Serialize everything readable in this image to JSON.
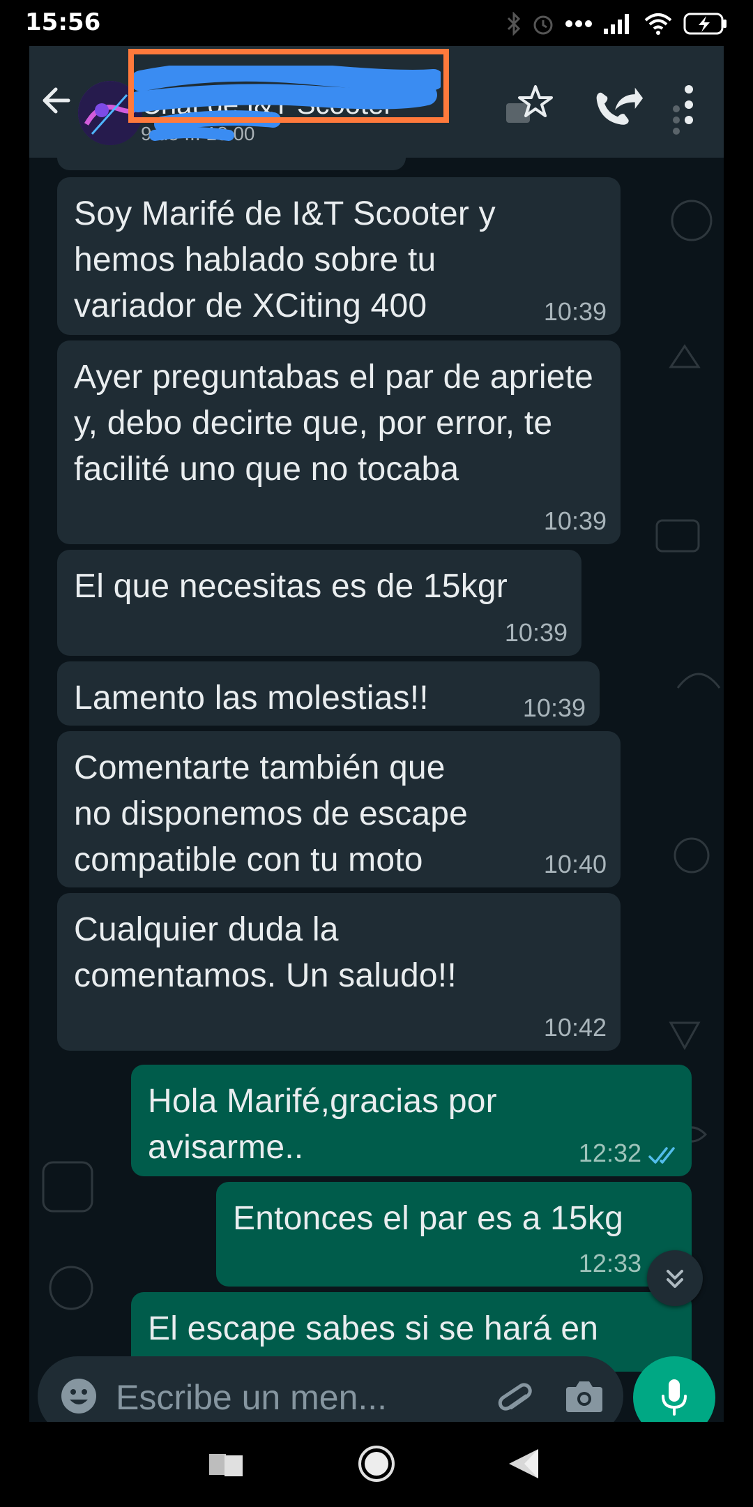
{
  "status_bar": {
    "time": "15:56"
  },
  "header": {
    "contact_name": "Chat de I&T Scooter",
    "contact_status": "9 de ... 18:00"
  },
  "messages": [
    {
      "direction": "in",
      "text": "Soy Marifé de I&T Scooter y hemos hablado sobre tu variador de XCiting 400",
      "time": "10:39"
    },
    {
      "direction": "in",
      "text": "Ayer preguntabas el par de apriete y, debo decirte que, por error, te facilité uno que no tocaba",
      "time": "10:39"
    },
    {
      "direction": "in",
      "text": "El que necesitas es de 15kgr",
      "time": "10:39"
    },
    {
      "direction": "in",
      "text": "Lamento las molestias!!",
      "time": "10:39"
    },
    {
      "direction": "in",
      "text": "Comentarte también que no disponemos de escape compatible con tu moto",
      "time": "10:40"
    },
    {
      "direction": "in",
      "text": "Cualquier duda la comentamos. Un saludo!!",
      "time": "10:42"
    },
    {
      "direction": "out",
      "text": "Hola Marifé,gracias por avisarme..",
      "time": "12:32",
      "status": "read"
    },
    {
      "direction": "out",
      "text": "Entonces el par es a 15kg",
      "time": "12:33"
    },
    {
      "direction": "out",
      "text": "El escape sabes si se hará en",
      "time": ""
    }
  ],
  "composer": {
    "placeholder": "Escribe un men..."
  },
  "colors": {
    "incoming_bubble": "#1f2c34",
    "outgoing_bubble": "#005c4b",
    "accent": "#00a884",
    "read_ticks": "#53bdeb",
    "redaction_box": "#ff7a3c",
    "redaction_scribble": "#3a8cf2"
  },
  "icons": [
    "back-arrow-icon",
    "star-icon",
    "forward-icon",
    "more-vert-icon",
    "emoji-icon",
    "attach-icon",
    "camera-icon",
    "mic-icon",
    "scroll-down-icon"
  ]
}
